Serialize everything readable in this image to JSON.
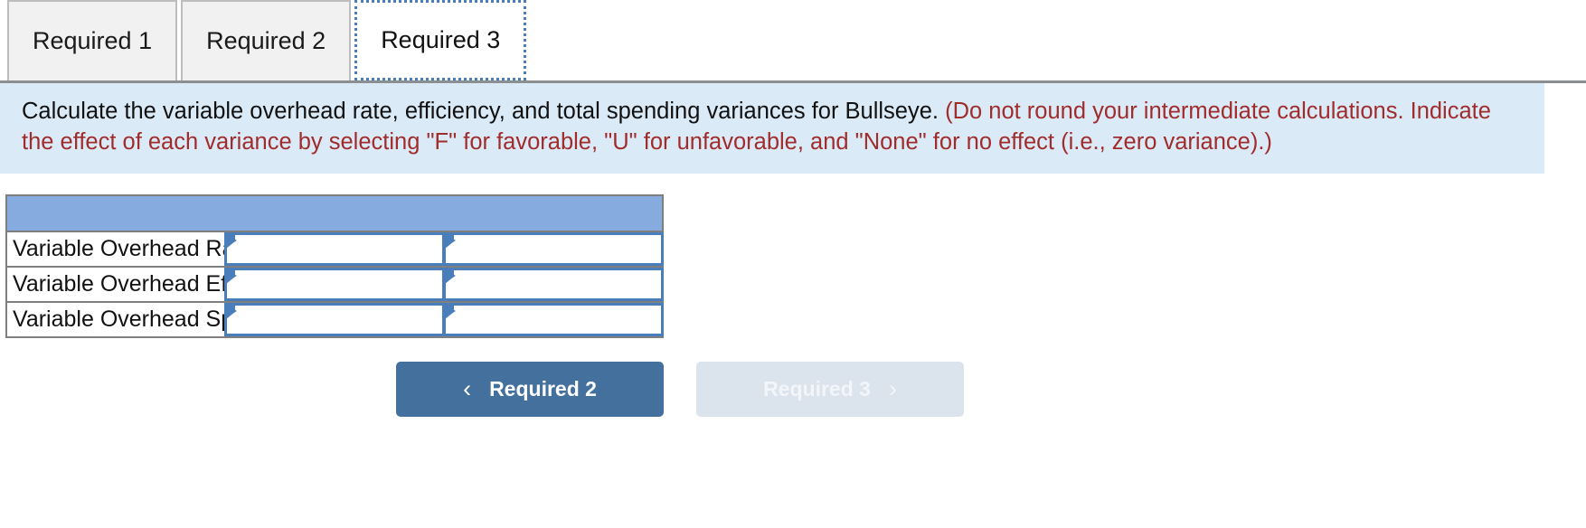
{
  "tabs": [
    {
      "label": "Required 1",
      "active": false
    },
    {
      "label": "Required 2",
      "active": false
    },
    {
      "label": "Required 3",
      "active": true
    }
  ],
  "instruction": {
    "main": "Calculate the variable overhead rate, efficiency, and total spending variances for Bullseye.",
    "hint": "(Do not round your intermediate calculations. Indicate the effect of each variance by selecting \"F\" for favorable, \"U\" for unfavorable, and \"None\" for no effect (i.e., zero variance).)",
    "bg_color": "#dbeaf7",
    "hint_color": "#a02c2c"
  },
  "answer_table": {
    "header_color": "#85abdf",
    "header_label": "",
    "rows": [
      {
        "label": "Variable Overhead Rate Variance",
        "amount": "",
        "effect": ""
      },
      {
        "label": "Variable Overhead Efficiency Variance",
        "amount": "",
        "effect": ""
      },
      {
        "label": "Variable Overhead Spending Variance",
        "amount": "",
        "effect": ""
      }
    ]
  },
  "nav": {
    "prev": {
      "label": "Required 2",
      "icon": "chevron-left-icon",
      "glyph": "‹",
      "enabled": true,
      "color": "#44709e"
    },
    "next": {
      "label": "Required 3",
      "icon": "chevron-right-icon",
      "glyph": "›",
      "enabled": false,
      "color": "#dbe3ec"
    }
  }
}
